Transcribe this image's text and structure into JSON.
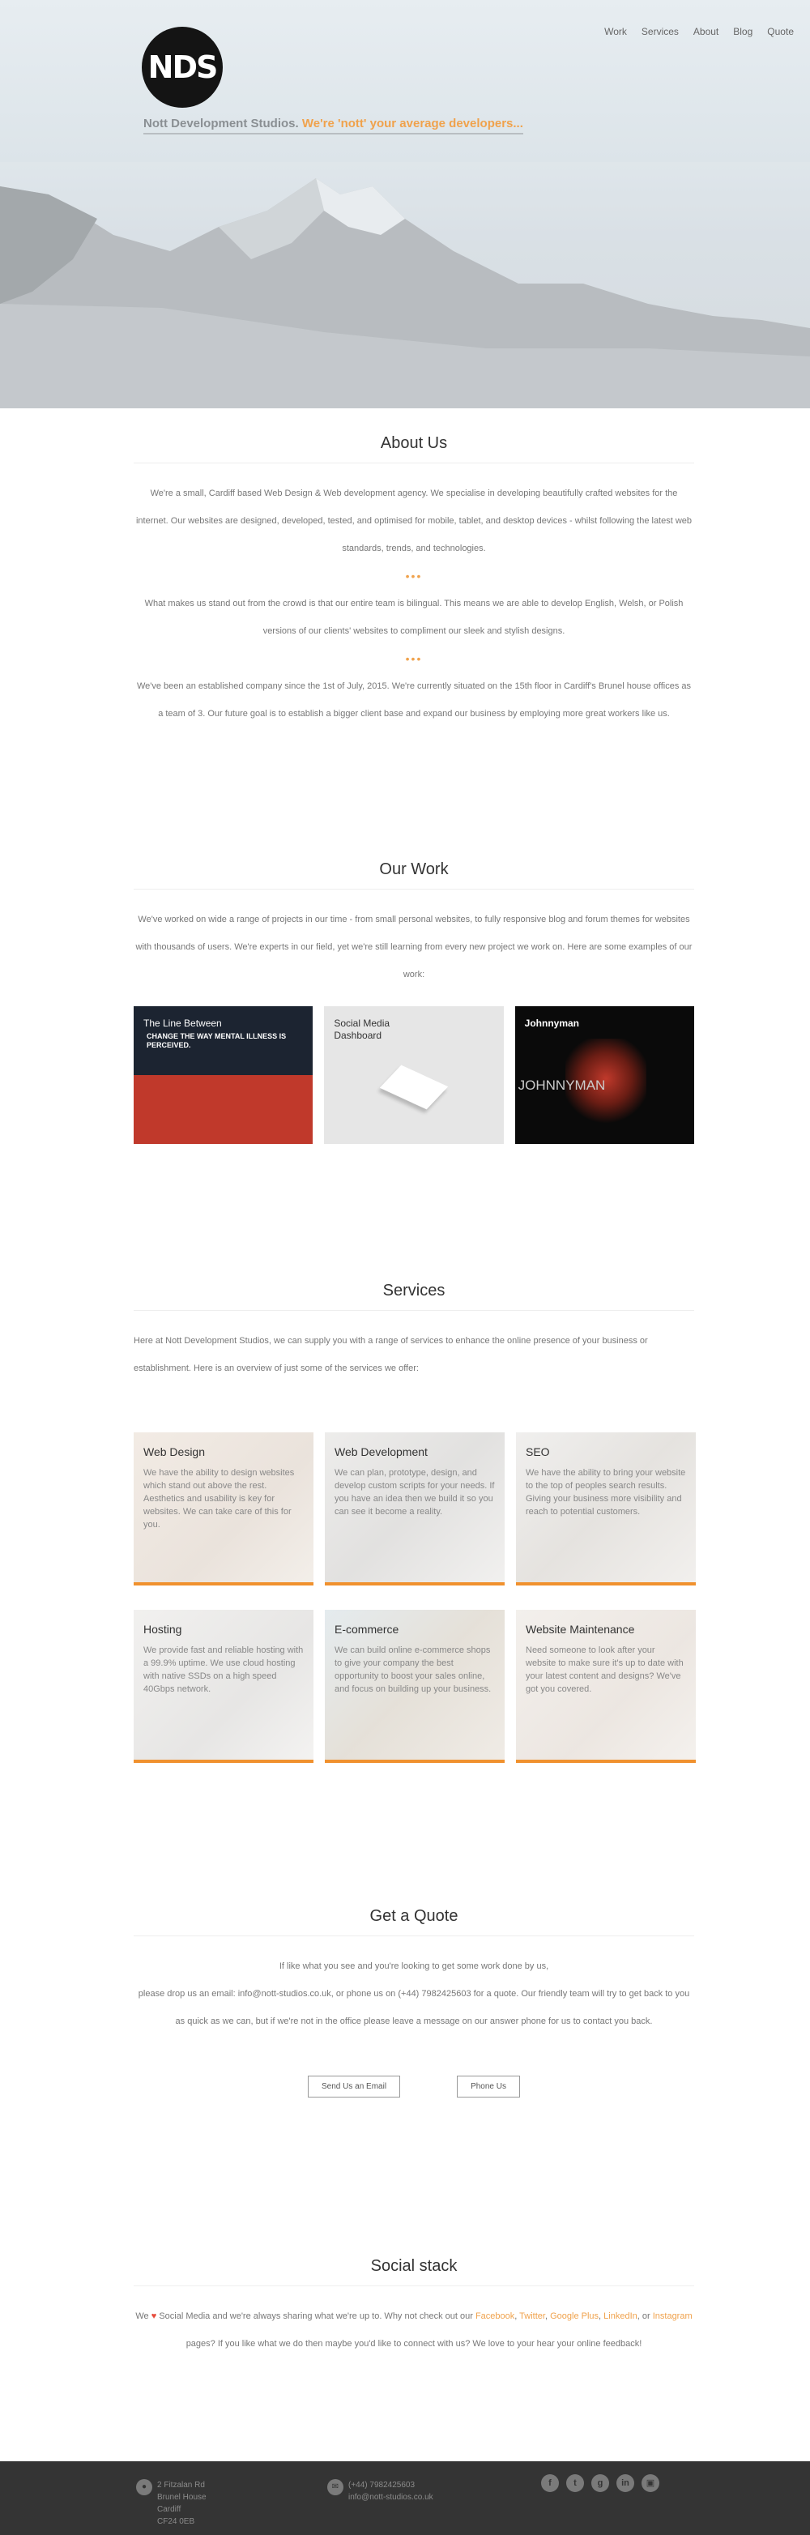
{
  "header": {
    "logo_text": "NDS",
    "company": "Nott Development Studios.",
    "slogan": "We're 'nott' your average developers...",
    "nav": [
      "Work",
      "Services",
      "About",
      "Blog",
      "Quote"
    ]
  },
  "about": {
    "title": "About Us",
    "p1": "We're a small, Cardiff based Web Design & Web development agency. We specialise in developing beautifully crafted websites for the internet. Our websites are designed, developed, tested, and optimised for mobile, tablet, and desktop devices - whilst following the latest web standards, trends, and technologies.",
    "p2": "What makes us stand out from the crowd is that our entire team is bilingual. This means we are able to develop English, Welsh, or Polish versions of our clients' websites to compliment our sleek and stylish designs.",
    "p3": "We've been an established company since the 1st of July, 2015. We're currently situated on the 15th floor in Cardiff's Brunel house offices as a team of 3. Our future goal is to establish a bigger client base and expand our business by employing more great workers like us.",
    "dots": "•••"
  },
  "work": {
    "title": "Our Work",
    "intro": "We've worked on wide a range of projects in our time - from small personal websites, to fully responsive blog and forum themes for websites with thousands of users. We're experts in our field, yet we're still learning from every new project we work on. Here are some examples of our work:",
    "items": [
      {
        "label": "The Line Between",
        "sub": "CHANGE THE WAY MENTAL ILLNESS IS PERCEIVED."
      },
      {
        "label": "Social Media Dashboard"
      },
      {
        "label": "Johnnyman",
        "sub": "JOHNNYMAN"
      }
    ]
  },
  "services": {
    "title": "Services",
    "intro": "Here at Nott Development Studios, we can supply you with a range of services to enhance the online presence of your business or establishment. Here is an overview of just some of the services we offer:",
    "items": [
      {
        "title": "Web Design",
        "text": "We have the ability to design websites which stand out above the rest. Aesthetics and usability is key for websites. We can take care of this for you."
      },
      {
        "title": "Web Development",
        "text": "We can plan, prototype, design, and develop custom scripts for your needs. If you have an idea then we build it so you can see it become a reality."
      },
      {
        "title": "SEO",
        "text": "We have the ability to bring your website to the top of peoples search results. Giving your business more visibility and reach to potential customers."
      },
      {
        "title": "Hosting",
        "text": "We provide fast and reliable hosting with a 99.9% uptime. We use cloud hosting with native SSDs on a high speed 40Gbps network."
      },
      {
        "title": "E-commerce",
        "text": "We can build online e-commerce shops to give your company the best opportunity to boost your sales online, and focus on building up your business."
      },
      {
        "title": "Website Maintenance",
        "text": "Need someone to look after your website to make sure it's up to date with your latest content and designs? We've got you covered."
      }
    ]
  },
  "quote": {
    "title": "Get a Quote",
    "line1": "If like what you see and you're looking to get some work done by us,",
    "line2": "please drop us an email: info@nott-studios.co.uk, or phone us on (+44) 7982425603 for a quote. Our friendly team will try to get back to you as quick as we can, but if we're not in the office please leave a message on our answer phone for us to contact you back.",
    "email_btn": "Send Us an Email",
    "phone_btn": "Phone Us"
  },
  "social_stack": {
    "title": "Social stack",
    "pre": "We",
    "heart": "♥",
    "mid": "Social Media and we're always sharing what we're up to. Why not check out our",
    "links": [
      "Facebook",
      "Twitter",
      "Google Plus",
      "LinkedIn",
      "Instagram"
    ],
    "sep1": ",",
    "sep_or": ", or",
    "post": "pages? If you like what we do then maybe you'd like to connect with us? We love to your hear your online feedback!"
  },
  "footer": {
    "address": [
      "2 Fitzalan Rd",
      "Brunel House",
      "Cardiff",
      "CF24 0EB"
    ],
    "phone": "(+44) 7982425603",
    "email": "info@nott-studios.co.uk",
    "social_icons": [
      "facebook-icon",
      "twitter-icon",
      "google-plus-icon",
      "linkedin-icon",
      "instagram-icon"
    ]
  },
  "colors": {
    "accent": "#f0a24c",
    "footer_bg": "#343434"
  }
}
